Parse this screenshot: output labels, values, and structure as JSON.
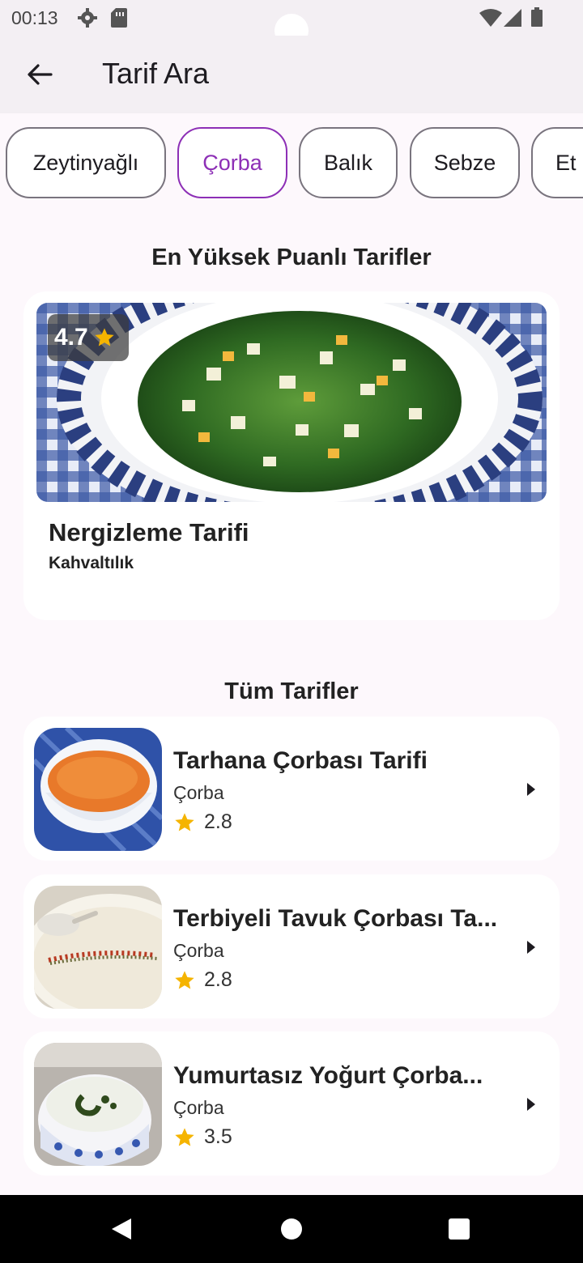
{
  "status_bar": {
    "time": "00:13"
  },
  "app_bar": {
    "title": "Tarif Ara"
  },
  "chips": [
    {
      "label": "Zeytinyağlı",
      "selected": false
    },
    {
      "label": "Çorba",
      "selected": true
    },
    {
      "label": "Balık",
      "selected": false
    },
    {
      "label": "Sebze",
      "selected": false
    },
    {
      "label": "Et",
      "selected": false
    }
  ],
  "featured": {
    "section_title": "En Yüksek Puanlı Tarifler",
    "rating": "4.7",
    "name": "Nergizleme Tarifi",
    "category": "Kahvaltılık"
  },
  "all_recipes": {
    "section_title": "Tüm Tarifler",
    "items": [
      {
        "name": "Tarhana Çorbası Tarifi",
        "category": "Çorba",
        "rating": "2.8"
      },
      {
        "name": "Terbiyeli Tavuk Çorbası Ta...",
        "category": "Çorba",
        "rating": "2.8"
      },
      {
        "name": "Yumurtasız Yoğurt Çorba...",
        "category": "Çorba",
        "rating": "3.5"
      }
    ]
  },
  "colors": {
    "accent": "#8d2fb6",
    "star": "#f5b400",
    "background": "#fdf8fc",
    "app_bar": "#f3eff3"
  }
}
